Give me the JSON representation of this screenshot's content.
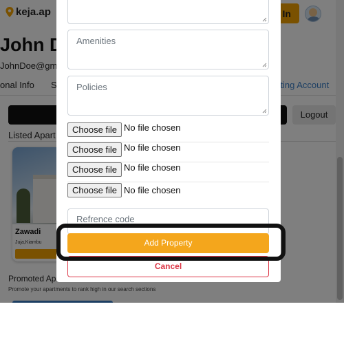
{
  "header": {
    "logo_text": "keja.ap",
    "sign_in_label": "In"
  },
  "profile": {
    "name": "John D",
    "email": "JohnDoe@gm"
  },
  "tabs": {
    "personal_info": "onal Info",
    "second": "S",
    "listing_account": "isting Account"
  },
  "actions": {
    "logout_label": "Logout"
  },
  "listed": {
    "heading": "Listed Apart",
    "cards": [
      {
        "title": "Zawadi",
        "location": "Juja,Kiambu",
        "button_label": "P"
      }
    ]
  },
  "promoted": {
    "heading": "Promoted Ap",
    "subtitle": "Promote your apartments to rank high in our search sections"
  },
  "modal": {
    "fields": {
      "amenities_placeholder": "Amenities",
      "policies_placeholder": "Policies",
      "refcode_placeholder": "Refrence code"
    },
    "file_inputs": [
      {
        "button": "Choose file",
        "status": "No file chosen"
      },
      {
        "button": "Choose file",
        "status": "No file chosen"
      },
      {
        "button": "Choose file",
        "status": "No file chosen"
      },
      {
        "button": "Choose file",
        "status": "No file chosen"
      }
    ],
    "add_property_label": "Add Property",
    "cancel_label": "Cancel"
  },
  "colors": {
    "accent": "#f4a61c",
    "danger": "#dc3545",
    "link": "#3a7ec7",
    "overlay": "rgba(0,0,0,0.5)"
  }
}
